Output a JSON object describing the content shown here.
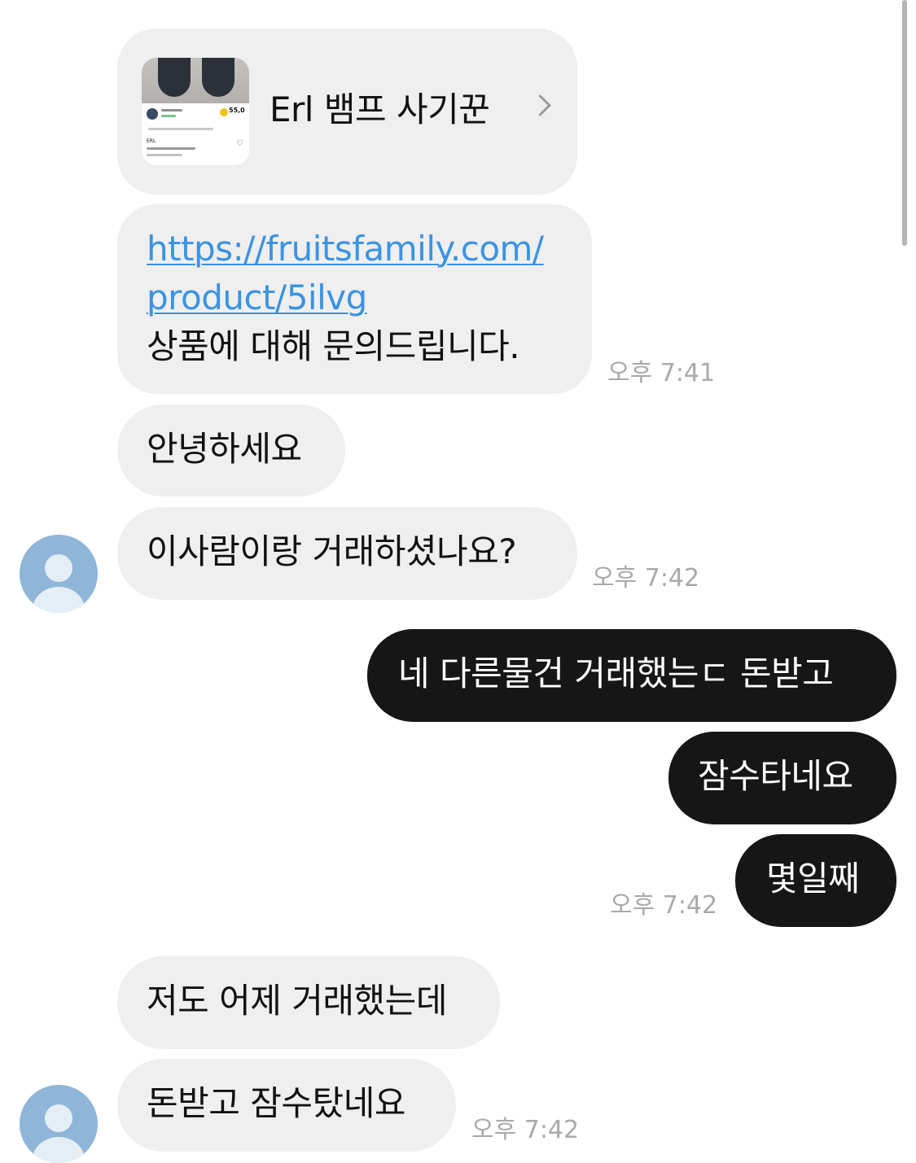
{
  "product_card": {
    "title": "Erl 뱀프 사기꾼",
    "thumb_price": "55,0",
    "thumb_brand": "ERL"
  },
  "messages": {
    "m1_link_line1": "https://fruitsfamily.com/",
    "m1_link_line2": "product/5ilvg",
    "m1_text": "상품에 대해 문의드립니다.",
    "m1_time": "오후 7:41",
    "m2_text": "안녕하세요",
    "m3_text": "이사람이랑 거래하셨나요?",
    "m3_time": "오후 7:42",
    "m4_text": "네 다른물건 거래했는ㄷ 돈받고",
    "m5_text": "잠수타네요",
    "m6_text": "몇일째",
    "m6_time": "오후 7:42",
    "m7_text": "저도 어제 거래했는데",
    "m8_text": "돈받고 잠수탔네요",
    "m8_time": "오후 7:42"
  },
  "colors": {
    "incoming": "#efefef",
    "outgoing": "#161616",
    "link": "#3a93e5",
    "avatar": "#8fb6d8"
  },
  "icons": {
    "avatar": "user-silhouette-icon",
    "chevron": "chevron-right-icon"
  }
}
